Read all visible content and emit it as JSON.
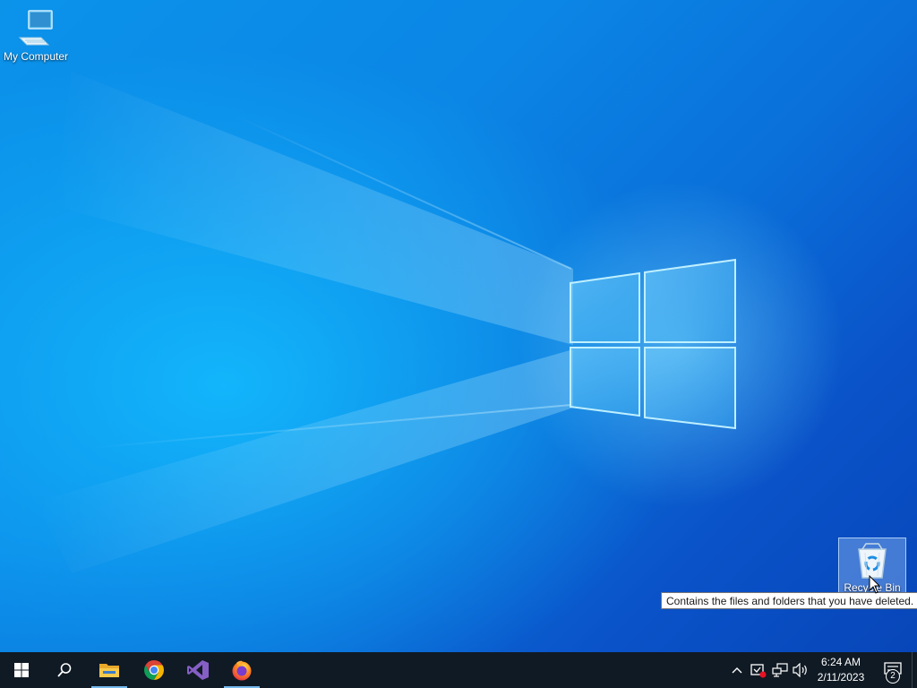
{
  "desktop": {
    "icons": [
      {
        "label": "My Computer",
        "icon": "computer-icon"
      },
      {
        "label": "Recycle Bin",
        "icon": "recycle-bin-icon"
      }
    ],
    "tooltip": "Contains the files and folders that you have deleted."
  },
  "taskbar": {
    "start_icon": "windows-start-icon",
    "search_icon": "search-icon",
    "pinned": [
      {
        "name": "File Explorer",
        "icon": "folder-icon",
        "active": true
      },
      {
        "name": "Google Chrome",
        "icon": "chrome-icon",
        "active": false
      },
      {
        "name": "Visual Studio",
        "icon": "visual-studio-icon",
        "active": false
      },
      {
        "name": "Firefox",
        "icon": "firefox-icon",
        "active": true
      }
    ],
    "tray": {
      "icons": [
        "chevron-up-icon",
        "security-icon",
        "network-icon",
        "volume-icon"
      ]
    },
    "clock": {
      "time": "6:24 AM",
      "date": "2/11/2023"
    },
    "notifications": {
      "count": "2"
    }
  },
  "colors": {
    "taskbar_bg": "#101a24",
    "active_indicator": "#76b9ed",
    "desktop_accent": "#0b86e6"
  }
}
